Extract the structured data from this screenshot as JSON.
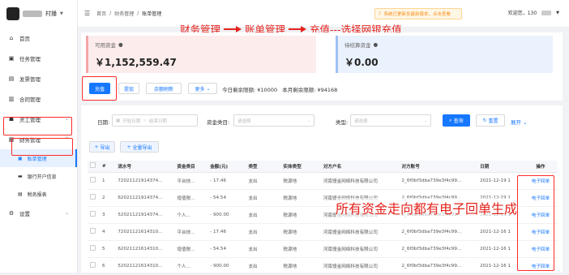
{
  "brand": {
    "name": "村播"
  },
  "sidebar": {
    "items": [
      {
        "label": "首页",
        "icon": "home-icon",
        "glyph": "⌂"
      },
      {
        "label": "任务管理",
        "icon": "task-icon",
        "glyph": "▣"
      },
      {
        "label": "发票管理",
        "icon": "invoice-icon",
        "glyph": "▤"
      },
      {
        "label": "合同管理",
        "icon": "contract-icon",
        "glyph": "▥"
      },
      {
        "label": "灵工管理",
        "icon": "worker-icon",
        "glyph": "☗"
      },
      {
        "label": "财务管理",
        "icon": "finance-icon",
        "glyph": "▦"
      }
    ],
    "sub_items": [
      {
        "label": "账单管理"
      },
      {
        "label": "银行开户信息"
      },
      {
        "label": "税务报表"
      }
    ],
    "settings": {
      "label": "设置"
    }
  },
  "header": {
    "breadcrumb": [
      "首页",
      "财务管理",
      "账单管理"
    ],
    "notice": "系统已更新至最新版本，点击查看",
    "welcome": "欢迎您，130"
  },
  "annotation": {
    "step1": "财务管理",
    "step2": "账单管理",
    "step3": "充值---选择网银充值",
    "bottom": "所有资金走向都有电子回单生成"
  },
  "cards": {
    "available": {
      "label": "可用资金",
      "value": "￥1,152,559.47"
    },
    "pending": {
      "label": "待结算资金",
      "value": "￥0.00"
    }
  },
  "actions": {
    "recharge": "充值",
    "withdraw": "提现",
    "refresh": "余额刷新",
    "more": "更多",
    "daily_limit_label": "今日剩余限额:",
    "daily_limit": "¥10000",
    "monthly_limit_label": "本月剩余限额:",
    "monthly_limit": "¥94168"
  },
  "filters": {
    "date_label": "日期:",
    "date_start": "开始日期",
    "date_sep": "~",
    "date_end": "结束日期",
    "fund_type_label": "资金类目:",
    "fund_type_placeholder": "请选择",
    "type_label": "类型:",
    "type_placeholder": "请选择",
    "search": "查询",
    "reset": "重置",
    "expand": "展开"
  },
  "export": {
    "export": "导出",
    "export_all": "全量导出"
  },
  "table": {
    "headers": [
      "#",
      "流水号",
      "资金类目",
      "金额(元)",
      "类型",
      "实体类型",
      "对方户名",
      "对方账号",
      "日期",
      "操作"
    ],
    "rows": [
      [
        "1",
        "72021121914374...",
        "平台技...",
        "- 17.46",
        "支出",
        "税源地",
        "河南馒金网络科技有限公司",
        "2_6f0bf3dba739e3f4c99...",
        "2021-12-19 1",
        "电子回单"
      ],
      [
        "2",
        "62021121914374...",
        "增值税...",
        "- 54.54",
        "支出",
        "税源地",
        "河南馒金网络科技有限公司",
        "2_6f0bf3dba739e3f4c99...",
        "2021-12-19 1",
        "电子回单"
      ],
      [
        "3",
        "52021121914374...",
        "个人...",
        "- 900.00",
        "支出",
        "税源地",
        "河南馒金网络科技有限公司",
        "2_6f0bf3dba739e3f4c99...",
        "2021-12-19 1",
        "电子回单"
      ],
      [
        "4",
        "72021121614310...",
        "平台技...",
        "- 17.46",
        "支出",
        "税源地",
        "河南馒金网络科技有限公司",
        "2_6f0bf3dba739e3f4c99...",
        "2021-12-16 1",
        "电子回单"
      ],
      [
        "5",
        "62021121614310...",
        "增值税...",
        "- 54.54",
        "支出",
        "税源地",
        "河南馒金网络科技有限公司",
        "2_6f0bf3dba739e3f4c99...",
        "2021-12-16 1",
        "电子回单"
      ],
      [
        "6",
        "52021121614310...",
        "个人...",
        "- 900.00",
        "支出",
        "税源地",
        "河南馒金网络科技有限公司",
        "2_6f0bf3dba739e3f4c99...",
        "2021-12-16 1",
        "电子回单"
      ]
    ]
  }
}
